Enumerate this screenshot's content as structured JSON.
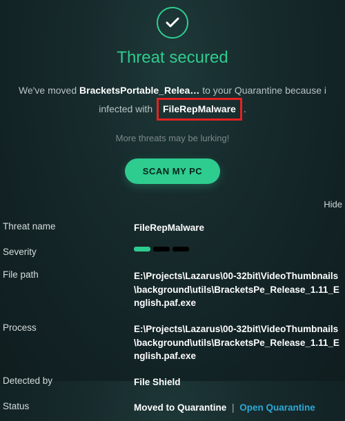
{
  "header": {
    "title": "Threat secured",
    "msg_prefix": "We've moved",
    "filename": "BracketsPortable_Relea…",
    "msg_mid": "to your Quarantine because i",
    "msg_infected": "infected with",
    "threat_highlight": "FileRepMalware",
    "period": ".",
    "lurking": "More threats may be lurking!",
    "scan_label": "SCAN MY PC"
  },
  "details_toggle": "Hide",
  "rows": {
    "threat_name": {
      "label": "Threat name",
      "value": "FileRepMalware"
    },
    "severity": {
      "label": "Severity",
      "level": 1,
      "max": 3
    },
    "file_path": {
      "label": "File path",
      "value": "E:\\Projects\\Lazarus\\00-32bit\\VideoThumbnails\\background\\utils\\BracketsPe_Release_1.11_English.paf.exe"
    },
    "process": {
      "label": "Process",
      "value": "E:\\Projects\\Lazarus\\00-32bit\\VideoThumbnails\\background\\utils\\BracketsPe_Release_1.11_English.paf.exe"
    },
    "detected_by": {
      "label": "Detected by",
      "value": "File Shield"
    },
    "status": {
      "label": "Status",
      "value": "Moved to Quarantine",
      "link": "Open Quarantine"
    }
  }
}
